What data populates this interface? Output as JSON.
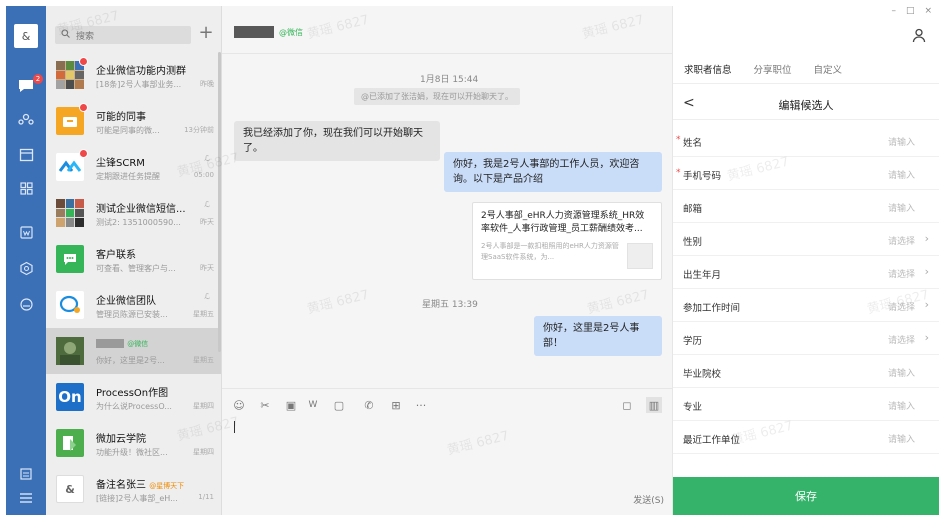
{
  "watermark": "黄瑶 6827",
  "rail": {
    "me_label": "&",
    "chat_badge": "2",
    "items": [
      "chat-icon",
      "contacts-icon",
      "calendar-icon",
      "apps-icon",
      "doc-icon",
      "cube-icon",
      "cloud-icon",
      "notes-icon",
      "menu-icon"
    ]
  },
  "list": {
    "search_placeholder": "搜索",
    "add_label": "+",
    "conversations": [
      {
        "name": "企业微信功能内测群",
        "preview": "[18条]2号人事部业务...",
        "time": "昨晚",
        "extra": "",
        "tag": ""
      },
      {
        "name": "可能的同事",
        "preview": "可能是同事的微...",
        "time": "13分钟前",
        "extra": "",
        "tag": ""
      },
      {
        "name": "尘锋SCRM",
        "preview": "定期跟进任务提醒",
        "time": "05:00",
        "extra": "ℒ",
        "tag": ""
      },
      {
        "name": "测试企业微信短信...",
        "preview": "测试2: 1351000590...",
        "time": "昨天",
        "extra": "ℒ",
        "tag": ""
      },
      {
        "name": "客户联系",
        "preview": "可查看、管理客户与...",
        "time": "昨天",
        "extra": "",
        "tag": ""
      },
      {
        "name": "企业微信团队",
        "preview": "管理员陈源已安装...",
        "time": "星期五",
        "extra": "ℒ",
        "tag": ""
      },
      {
        "name": "",
        "preview": "你好，这里是2号...",
        "time": "星期五",
        "extra": "",
        "tag": "@微信"
      },
      {
        "name": "ProcessOn作图",
        "preview": "为什么说ProcessO...",
        "time": "星期四",
        "extra": "",
        "tag": ""
      },
      {
        "name": "微加云学院",
        "preview": "功能升级！微社区...",
        "time": "星期四",
        "extra": "",
        "tag": ""
      },
      {
        "name": "备注名张三",
        "preview": "[链接]2号人事部_eH...",
        "time": "1/11",
        "extra": "",
        "tag": "@星博天下"
      }
    ]
  },
  "chat": {
    "title": "",
    "subtitle": "@微信",
    "date_label": "1月8日 15:44",
    "added_notice": "@已添加了张洁娟，现在可以开始聊天了。",
    "msg_in": "我已经添加了你，现在我们可以开始聊天了。",
    "msg_out1": "你好，我是2号人事部的工作人员，欢迎咨询。以下是产品介绍",
    "card_title": "2号人事部_eHR人力资源管理系统_HR效率软件_人事行政管理_员工薪酬绩效考...",
    "card_desc": "2号人事部是一款扣租照用的eHR人力资源管理SaaS软件系统，为...",
    "date_label2": "星期五 13:39",
    "msg_out2": "你好，这里是2号人事部！",
    "send_label": "发送(S)",
    "toolbar_glyphs": [
      "☺",
      "✂",
      "▣",
      "W",
      "▢",
      "✆",
      "⊞",
      "···"
    ],
    "toolbar_right": [
      "◻",
      "▥"
    ]
  },
  "panel": {
    "window_controls": [
      "–",
      "□",
      "×"
    ],
    "tabs": [
      "求职者信息",
      "分享职位",
      "自定义"
    ],
    "active_tab": 0,
    "back_label": "<",
    "title": "编辑候选人",
    "fields": [
      {
        "label": "姓名",
        "required": true,
        "value": "请输入",
        "arrow": false
      },
      {
        "label": "手机号码",
        "required": true,
        "value": "请输入",
        "arrow": false
      },
      {
        "label": "邮箱",
        "required": false,
        "value": "请输入",
        "arrow": false
      },
      {
        "label": "性别",
        "required": false,
        "value": "请选择",
        "arrow": true
      },
      {
        "label": "出生年月",
        "required": false,
        "value": "请选择",
        "arrow": true
      },
      {
        "label": "参加工作时间",
        "required": false,
        "value": "请选择",
        "arrow": true
      },
      {
        "label": "学历",
        "required": false,
        "value": "请选择",
        "arrow": true
      },
      {
        "label": "毕业院校",
        "required": false,
        "value": "请输入",
        "arrow": false
      },
      {
        "label": "专业",
        "required": false,
        "value": "请输入",
        "arrow": false
      },
      {
        "label": "最近工作单位",
        "required": false,
        "value": "请输入",
        "arrow": false
      }
    ],
    "save_label": "保存",
    "colors": {
      "accent": "#36b36a",
      "rail": "#3b6fb6",
      "bubble_out": "#c9dcf8",
      "required": "#f04848"
    }
  }
}
